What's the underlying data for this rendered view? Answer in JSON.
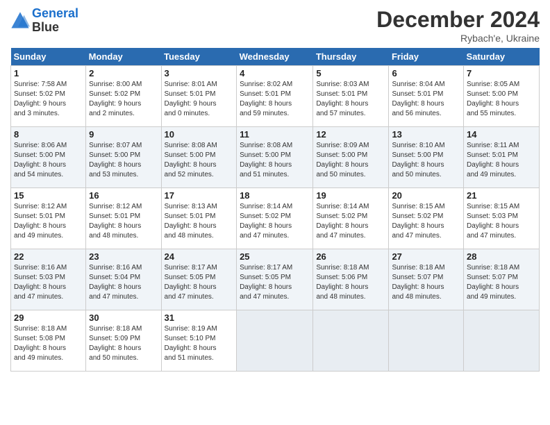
{
  "header": {
    "logo_line1": "General",
    "logo_line2": "Blue",
    "month": "December 2024",
    "location": "Rybach'e, Ukraine"
  },
  "weekdays": [
    "Sunday",
    "Monday",
    "Tuesday",
    "Wednesday",
    "Thursday",
    "Friday",
    "Saturday"
  ],
  "weeks": [
    [
      {
        "day": "1",
        "sunrise": "7:58 AM",
        "sunset": "5:02 PM",
        "daylight": "9 hours and 3 minutes."
      },
      {
        "day": "2",
        "sunrise": "8:00 AM",
        "sunset": "5:02 PM",
        "daylight": "9 hours and 2 minutes."
      },
      {
        "day": "3",
        "sunrise": "8:01 AM",
        "sunset": "5:01 PM",
        "daylight": "9 hours and 0 minutes."
      },
      {
        "day": "4",
        "sunrise": "8:02 AM",
        "sunset": "5:01 PM",
        "daylight": "8 hours and 59 minutes."
      },
      {
        "day": "5",
        "sunrise": "8:03 AM",
        "sunset": "5:01 PM",
        "daylight": "8 hours and 57 minutes."
      },
      {
        "day": "6",
        "sunrise": "8:04 AM",
        "sunset": "5:01 PM",
        "daylight": "8 hours and 56 minutes."
      },
      {
        "day": "7",
        "sunrise": "8:05 AM",
        "sunset": "5:00 PM",
        "daylight": "8 hours and 55 minutes."
      }
    ],
    [
      {
        "day": "8",
        "sunrise": "8:06 AM",
        "sunset": "5:00 PM",
        "daylight": "8 hours and 54 minutes."
      },
      {
        "day": "9",
        "sunrise": "8:07 AM",
        "sunset": "5:00 PM",
        "daylight": "8 hours and 53 minutes."
      },
      {
        "day": "10",
        "sunrise": "8:08 AM",
        "sunset": "5:00 PM",
        "daylight": "8 hours and 52 minutes."
      },
      {
        "day": "11",
        "sunrise": "8:08 AM",
        "sunset": "5:00 PM",
        "daylight": "8 hours and 51 minutes."
      },
      {
        "day": "12",
        "sunrise": "8:09 AM",
        "sunset": "5:00 PM",
        "daylight": "8 hours and 50 minutes."
      },
      {
        "day": "13",
        "sunrise": "8:10 AM",
        "sunset": "5:00 PM",
        "daylight": "8 hours and 50 minutes."
      },
      {
        "day": "14",
        "sunrise": "8:11 AM",
        "sunset": "5:01 PM",
        "daylight": "8 hours and 49 minutes."
      }
    ],
    [
      {
        "day": "15",
        "sunrise": "8:12 AM",
        "sunset": "5:01 PM",
        "daylight": "8 hours and 49 minutes."
      },
      {
        "day": "16",
        "sunrise": "8:12 AM",
        "sunset": "5:01 PM",
        "daylight": "8 hours and 48 minutes."
      },
      {
        "day": "17",
        "sunrise": "8:13 AM",
        "sunset": "5:01 PM",
        "daylight": "8 hours and 48 minutes."
      },
      {
        "day": "18",
        "sunrise": "8:14 AM",
        "sunset": "5:02 PM",
        "daylight": "8 hours and 47 minutes."
      },
      {
        "day": "19",
        "sunrise": "8:14 AM",
        "sunset": "5:02 PM",
        "daylight": "8 hours and 47 minutes."
      },
      {
        "day": "20",
        "sunrise": "8:15 AM",
        "sunset": "5:02 PM",
        "daylight": "8 hours and 47 minutes."
      },
      {
        "day": "21",
        "sunrise": "8:15 AM",
        "sunset": "5:03 PM",
        "daylight": "8 hours and 47 minutes."
      }
    ],
    [
      {
        "day": "22",
        "sunrise": "8:16 AM",
        "sunset": "5:03 PM",
        "daylight": "8 hours and 47 minutes."
      },
      {
        "day": "23",
        "sunrise": "8:16 AM",
        "sunset": "5:04 PM",
        "daylight": "8 hours and 47 minutes."
      },
      {
        "day": "24",
        "sunrise": "8:17 AM",
        "sunset": "5:05 PM",
        "daylight": "8 hours and 47 minutes."
      },
      {
        "day": "25",
        "sunrise": "8:17 AM",
        "sunset": "5:05 PM",
        "daylight": "8 hours and 47 minutes."
      },
      {
        "day": "26",
        "sunrise": "8:18 AM",
        "sunset": "5:06 PM",
        "daylight": "8 hours and 48 minutes."
      },
      {
        "day": "27",
        "sunrise": "8:18 AM",
        "sunset": "5:07 PM",
        "daylight": "8 hours and 48 minutes."
      },
      {
        "day": "28",
        "sunrise": "8:18 AM",
        "sunset": "5:07 PM",
        "daylight": "8 hours and 49 minutes."
      }
    ],
    [
      {
        "day": "29",
        "sunrise": "8:18 AM",
        "sunset": "5:08 PM",
        "daylight": "8 hours and 49 minutes."
      },
      {
        "day": "30",
        "sunrise": "8:18 AM",
        "sunset": "5:09 PM",
        "daylight": "8 hours and 50 minutes."
      },
      {
        "day": "31",
        "sunrise": "8:19 AM",
        "sunset": "5:10 PM",
        "daylight": "8 hours and 51 minutes."
      },
      null,
      null,
      null,
      null
    ]
  ]
}
